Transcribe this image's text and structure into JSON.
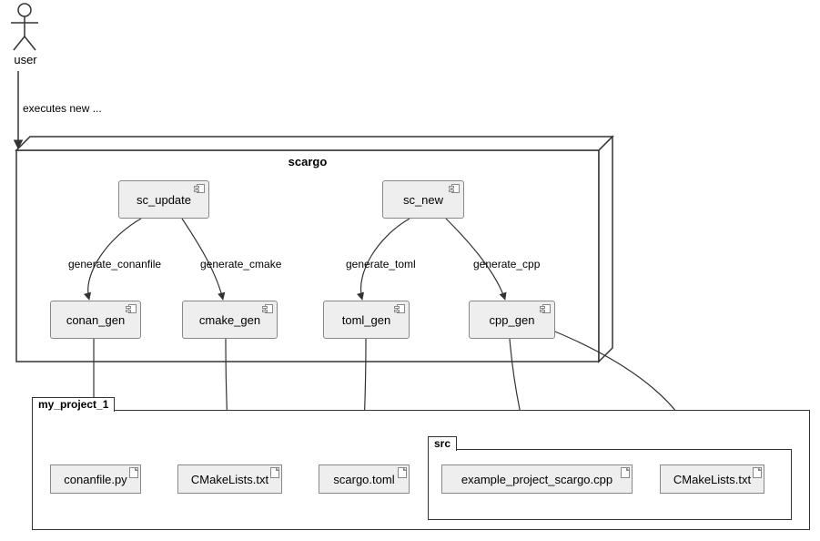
{
  "actor": {
    "label": "user"
  },
  "scargo": {
    "title": "scargo",
    "components": {
      "sc_update": "sc_update",
      "sc_new": "sc_new",
      "conan_gen": "conan_gen",
      "cmake_gen": "cmake_gen",
      "toml_gen": "toml_gen",
      "cpp_gen": "cpp_gen"
    }
  },
  "my_project_1": {
    "title": "my_project_1",
    "artifacts": {
      "conanfile": "conanfile.py",
      "cmakelists": "CMakeLists.txt",
      "scargo_toml": "scargo.toml"
    },
    "src": {
      "title": "src",
      "artifacts": {
        "example_cpp": "example_project_scargo.cpp",
        "cmakelists": "CMakeLists.txt"
      }
    }
  },
  "edges": {
    "user_to_scargo": "executes new ...",
    "generate_conanfile": "generate_conanfile",
    "generate_cmake": "generate_cmake",
    "generate_toml": "generate_toml",
    "generate_cpp": "generate_cpp"
  },
  "chart_data": {
    "type": "uml_component_diagram",
    "actors": [
      "user"
    ],
    "packages": [
      {
        "name": "scargo",
        "components": [
          "sc_update",
          "sc_new",
          "conan_gen",
          "cmake_gen",
          "toml_gen",
          "cpp_gen"
        ]
      },
      {
        "name": "my_project_1",
        "artifacts": [
          "conanfile.py",
          "CMakeLists.txt",
          "scargo.toml"
        ],
        "subpackages": [
          {
            "name": "src",
            "artifacts": [
              "example_project_scargo.cpp",
              "CMakeLists.txt"
            ]
          }
        ]
      }
    ],
    "relations": [
      {
        "from": "user",
        "to": "scargo",
        "label": "executes new ..."
      },
      {
        "from": "sc_update",
        "to": "conan_gen",
        "label": "generate_conanfile"
      },
      {
        "from": "sc_update",
        "to": "cmake_gen",
        "label": "generate_cmake"
      },
      {
        "from": "sc_new",
        "to": "toml_gen",
        "label": "generate_toml"
      },
      {
        "from": "sc_new",
        "to": "cpp_gen",
        "label": "generate_cpp"
      },
      {
        "from": "conan_gen",
        "to": "conanfile.py"
      },
      {
        "from": "cmake_gen",
        "to": "CMakeLists.txt"
      },
      {
        "from": "toml_gen",
        "to": "scargo.toml"
      },
      {
        "from": "cpp_gen",
        "to": "example_project_scargo.cpp"
      },
      {
        "from": "cpp_gen",
        "to": "src/CMakeLists.txt"
      }
    ]
  }
}
